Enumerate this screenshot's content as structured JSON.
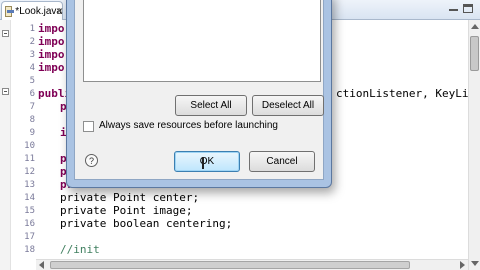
{
  "editor": {
    "tab": {
      "label": "*Look.java",
      "close": "✕"
    },
    "lines": [
      {
        "num": "1",
        "text": "import"
      },
      {
        "num": "2",
        "text": "import"
      },
      {
        "num": "3",
        "text": "import"
      },
      {
        "num": "4",
        "text": "import"
      },
      {
        "num": "5",
        "text": ""
      },
      {
        "num": "6",
        "text": "publi"
      },
      {
        "num": "7",
        "text": "po"
      },
      {
        "num": "8",
        "text": ""
      },
      {
        "num": "9",
        "text": "i"
      },
      {
        "num": "10",
        "text": ""
      },
      {
        "num": "11",
        "text": "pr"
      },
      {
        "num": "12",
        "text": "pr"
      },
      {
        "num": "13",
        "text": "pr"
      },
      {
        "num": "14",
        "text": "private Point center;"
      },
      {
        "num": "15",
        "text": "private Point image;"
      },
      {
        "num": "16",
        "text": "private boolean centering;"
      },
      {
        "num": "17",
        "text": ""
      },
      {
        "num": "18",
        "text": "//init"
      }
    ],
    "line6_tail": "ctionListener, KeyListe"
  },
  "dialog": {
    "select_all": "Select All",
    "deselect_all": "Deselect All",
    "checkbox_label": "Always save resources before launching",
    "help": "?",
    "ok": "OK",
    "cancel": "Cancel"
  }
}
